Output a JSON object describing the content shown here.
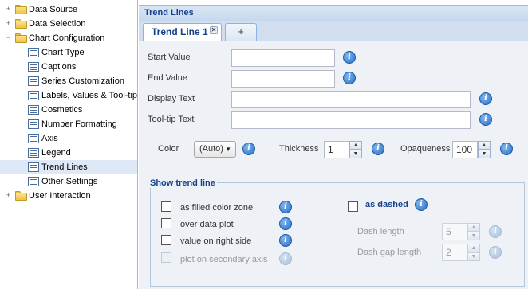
{
  "sidebar": {
    "items": [
      {
        "label": "Data Source",
        "toggle": "+"
      },
      {
        "label": "Data Selection",
        "toggle": "+"
      },
      {
        "label": "Chart Configuration",
        "toggle": "−"
      },
      {
        "label": "Chart Type"
      },
      {
        "label": "Captions"
      },
      {
        "label": "Series Customization"
      },
      {
        "label": "Labels, Values & Tool-tip"
      },
      {
        "label": "Cosmetics"
      },
      {
        "label": "Number Formatting"
      },
      {
        "label": "Axis"
      },
      {
        "label": "Legend"
      },
      {
        "label": "Trend Lines"
      },
      {
        "label": "Other Settings"
      },
      {
        "label": "User Interaction",
        "toggle": "+"
      }
    ]
  },
  "panel": {
    "title": "Trend Lines",
    "tabs": {
      "active": "Trend Line 1",
      "close": "✕",
      "add": "+"
    }
  },
  "form": {
    "start_value": {
      "label": "Start Value",
      "value": ""
    },
    "end_value": {
      "label": "End Value",
      "value": ""
    },
    "display_text": {
      "label": "Display Text",
      "value": ""
    },
    "tooltip_text": {
      "label": "Tool-tip Text",
      "value": ""
    },
    "color": {
      "label": "Color",
      "value": "(Auto)"
    },
    "thickness": {
      "label": "Thickness",
      "value": "1"
    },
    "opaqueness": {
      "label": "Opaqueness",
      "value": "100"
    }
  },
  "show_trend_line": {
    "legend": "Show trend line",
    "options": {
      "filled_zone": "as filled color zone",
      "over_data_plot": "over data plot",
      "value_right": "value on right side",
      "secondary_axis": "plot on secondary axis",
      "as_dashed": "as dashed"
    },
    "dash_length": {
      "label": "Dash length",
      "value": "5"
    },
    "dash_gap_length": {
      "label": "Dash gap length",
      "value": "2"
    }
  },
  "icons": {
    "info": "i",
    "spin_up": "▲",
    "spin_down": "▼",
    "combo_arrow": "▼"
  },
  "colors": {
    "accent": "#15428b",
    "selection": "#dfe8f6",
    "panel_bg": "#eef1f6"
  }
}
